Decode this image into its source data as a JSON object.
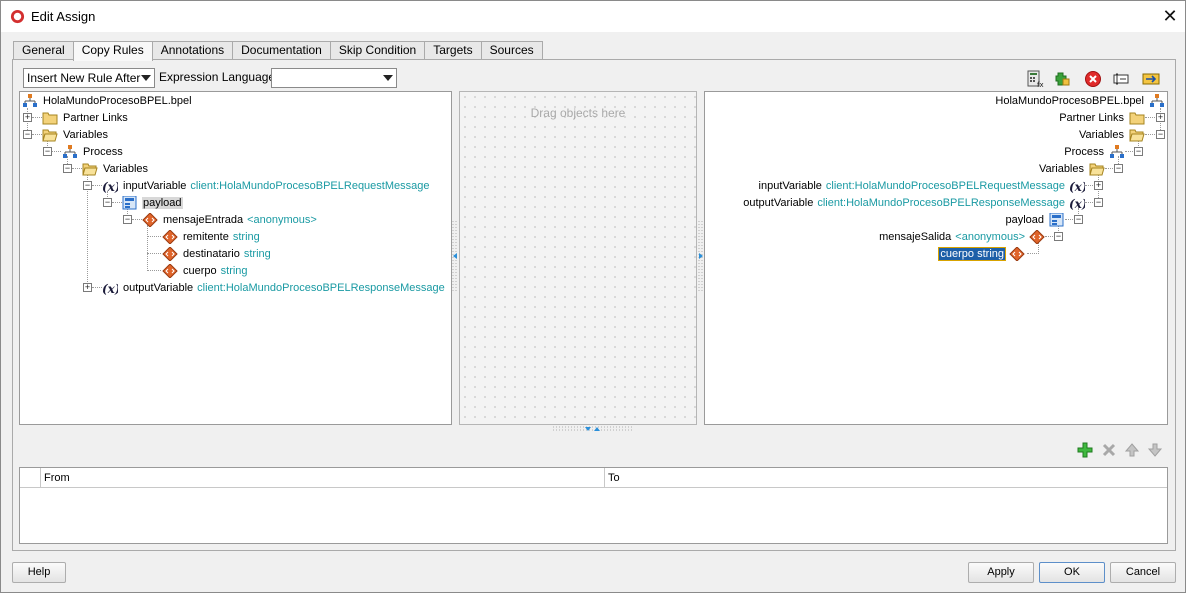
{
  "window": {
    "title": "Edit Assign"
  },
  "tabs": [
    {
      "label": "General"
    },
    {
      "label": "Copy Rules"
    },
    {
      "label": "Annotations"
    },
    {
      "label": "Documentation"
    },
    {
      "label": "Skip Condition"
    },
    {
      "label": "Targets"
    },
    {
      "label": "Sources"
    }
  ],
  "active_tab": "Copy Rules",
  "toolbar": {
    "insert_mode_value": "Insert New Rule After",
    "expression_language_label": "Expression Language:",
    "expression_language_value": ""
  },
  "source_tree": {
    "root": "HolaMundoProcesoBPEL.bpel",
    "partner_links": "Partner Links",
    "variables": "Variables",
    "process": "Process",
    "process_variables": "Variables",
    "input_variable": "inputVariable",
    "input_type": "client:HolaMundoProcesoBPELRequestMessage",
    "payload": "payload",
    "mensaje": "mensajeEntrada",
    "mensaje_type": "<anonymous>",
    "remitente": "remitente",
    "destinatario": "destinatario",
    "cuerpo": "cuerpo",
    "string_type": "string",
    "output_variable": "outputVariable",
    "output_type": "client:HolaMundoProcesoBPELResponseMessage"
  },
  "center_panel": {
    "hint": "Drag objects here"
  },
  "target_tree": {
    "root": "HolaMundoProcesoBPEL.bpel",
    "partner_links": "Partner Links",
    "variables": "Variables",
    "process": "Process",
    "process_variables": "Variables",
    "input_variable": "inputVariable",
    "input_type": "client:HolaMundoProcesoBPELRequestMessage",
    "output_variable": "outputVariable",
    "output_type": "client:HolaMundoProcesoBPELResponseMessage",
    "payload": "payload",
    "mensaje": "mensajeSalida",
    "mensaje_type": "<anonymous>",
    "cuerpo_selected": "cuerpo string"
  },
  "rules_table": {
    "columns": [
      "From",
      "To"
    ]
  },
  "buttons": {
    "help": "Help",
    "apply": "Apply",
    "ok": "OK",
    "cancel": "Cancel"
  }
}
